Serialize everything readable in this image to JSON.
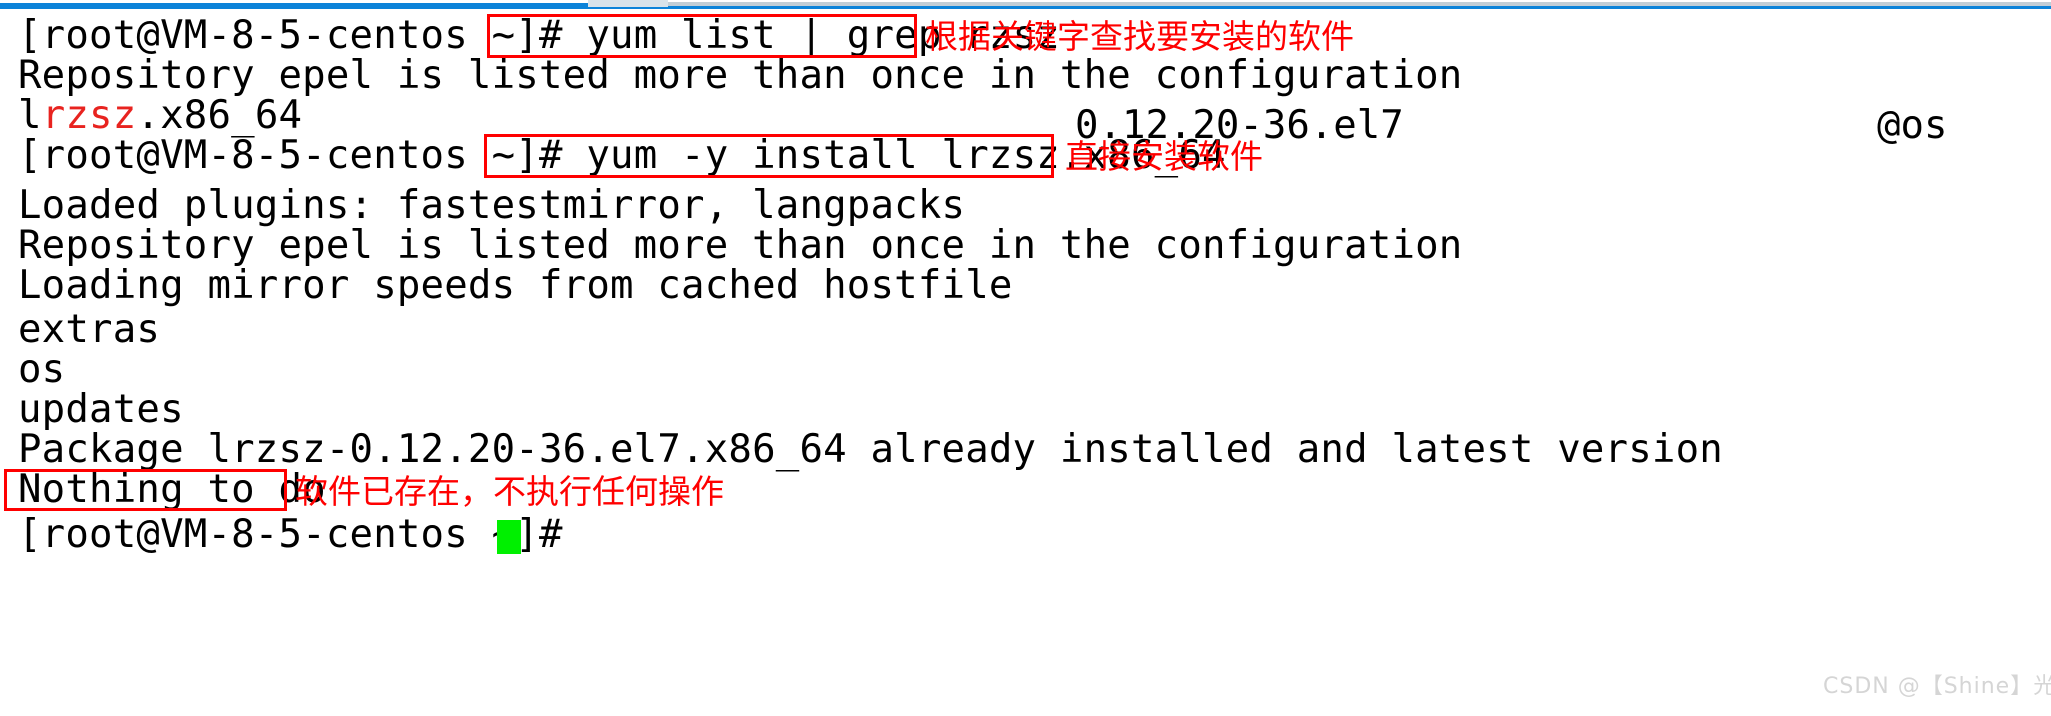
{
  "window": {
    "scrollbar": {
      "orientation": "horizontal",
      "track_color": "#0c83d9",
      "thumb_color": "#d8e3ea"
    }
  },
  "terminal": {
    "background": "#ffffff",
    "foreground": "#000000",
    "grep_highlight_color": "#e8231f",
    "cursor_color": "#00f000",
    "prompt": "[root@VM-8-5-centos ~]# ",
    "lines": [
      {
        "id": "line-1",
        "kind": "command",
        "prompt": "[root@VM-8-5-centos ~]# ",
        "command": "yum list | grep rzsz"
      },
      {
        "id": "line-2",
        "kind": "output",
        "text": "Repository epel is listed more than once in the configuration"
      },
      {
        "id": "line-3",
        "kind": "package",
        "name_prefix": "l",
        "name_match": "rzsz",
        "name_suffix": ".x86_64",
        "version": "0.12.20-36.el7",
        "repo": "@os"
      },
      {
        "id": "line-4",
        "kind": "command",
        "prompt": "[root@VM-8-5-centos ~]# ",
        "command": "yum -y install lrzsz.x86_64"
      },
      {
        "id": "line-5",
        "kind": "output",
        "text": "Loaded plugins: fastestmirror, langpacks"
      },
      {
        "id": "line-6",
        "kind": "output",
        "text": "Repository epel is listed more than once in the configuration"
      },
      {
        "id": "line-7",
        "kind": "output",
        "text": "Loading mirror speeds from cached hostfile"
      },
      {
        "id": "line-8",
        "kind": "output",
        "text": "extras"
      },
      {
        "id": "line-9",
        "kind": "output",
        "text": "os"
      },
      {
        "id": "line-10",
        "kind": "output",
        "text": "updates"
      },
      {
        "id": "line-11",
        "kind": "output",
        "text": "Package lrzsz-0.12.20-36.el7.x86_64 already installed and latest version"
      },
      {
        "id": "line-12",
        "kind": "output",
        "text": "Nothing to do"
      },
      {
        "id": "line-13",
        "kind": "prompt-only",
        "prompt": "[root@VM-8-5-centos ~]# "
      }
    ]
  },
  "annotations": {
    "color": "#ff0000",
    "notes": [
      {
        "id": "note-1",
        "text": "根据关键字查找要安装的软件"
      },
      {
        "id": "note-2",
        "text": "直接安装软件"
      },
      {
        "id": "note-3",
        "text": "软件已存在，不执行任何操作"
      }
    ],
    "highlight_boxes": [
      {
        "id": "box-command-1",
        "target": "yum list | grep rzsz"
      },
      {
        "id": "box-command-2",
        "target": "yum -y install lrzsz.x86_64"
      },
      {
        "id": "box-result",
        "target": "Nothing to do"
      }
    ]
  },
  "watermark": {
    "text": "CSDN @【Shine】光芒"
  }
}
